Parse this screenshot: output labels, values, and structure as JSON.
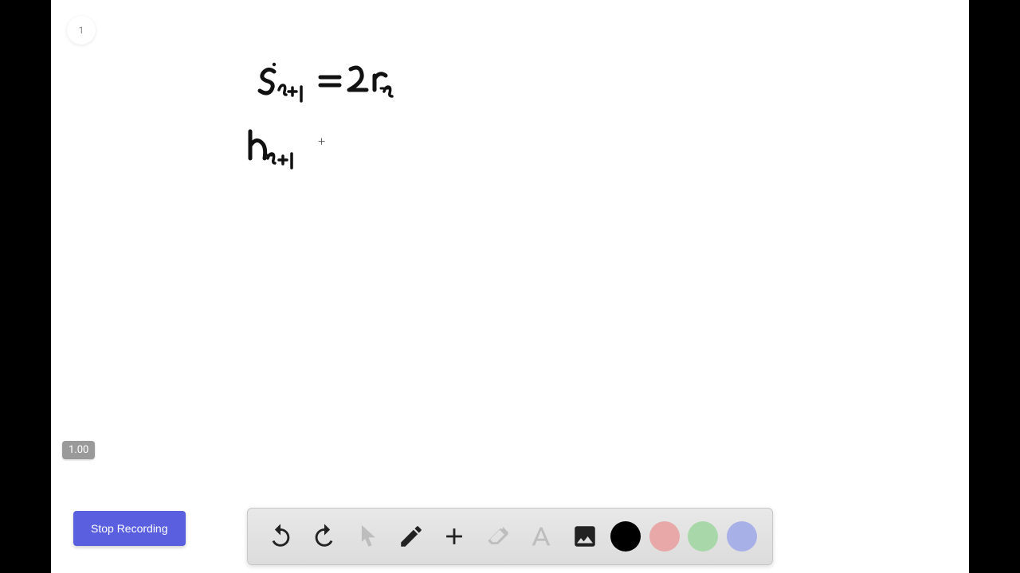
{
  "page_number": "1",
  "zoom_level": "1.00",
  "stop_button_label": "Stop Recording",
  "colors": {
    "black": "#000000",
    "pink": "#e9a8a8",
    "green": "#a8d8aa",
    "blue": "#a8b0e8",
    "eraser_dim": "#bdbdbd",
    "text_dim": "#bdbdbd",
    "pointer_dim": "#bdbdbd"
  },
  "handwriting": {
    "line1": "s_{t+1} = 2r_t",
    "line2": "h_{t+1}"
  }
}
